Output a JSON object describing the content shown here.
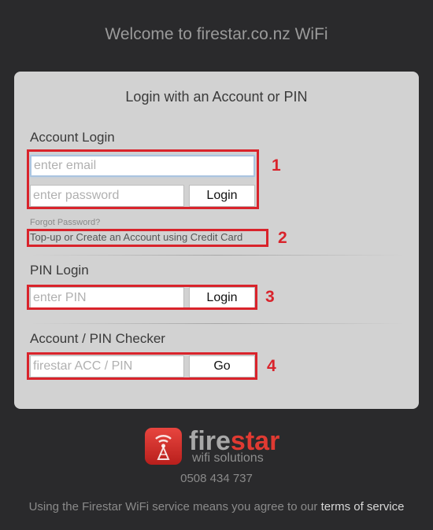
{
  "header": {
    "title": "Welcome to firestar.co.nz WiFi"
  },
  "panel": {
    "title": "Login with an Account or PIN",
    "account_login": {
      "label": "Account Login",
      "email_placeholder": "enter email",
      "password_placeholder": "enter password",
      "login_label": "Login",
      "forgot_password": "Forgot Password?",
      "topup_link": "Top-up or Create an Account using Credit Card"
    },
    "pin_login": {
      "label": "PIN Login",
      "pin_placeholder": "enter PIN",
      "login_label": "Login"
    },
    "checker": {
      "label": "Account / PIN Checker",
      "input_placeholder": "firestar ACC / PIN",
      "go_label": "Go"
    }
  },
  "annotations": [
    "1",
    "2",
    "3",
    "4"
  ],
  "logo": {
    "brand_part1": "fire",
    "brand_part2": "star",
    "tagline": "wifi solutions"
  },
  "phone": "0508 434 737",
  "footer": {
    "text": "Using the Firestar WiFi service means you agree to our ",
    "tos_link": "terms of service"
  },
  "colors": {
    "background": "#2a2a2c",
    "panel": "#d2d2d2",
    "annotation_red": "#d9232b",
    "brand_red": "#e03a32"
  }
}
